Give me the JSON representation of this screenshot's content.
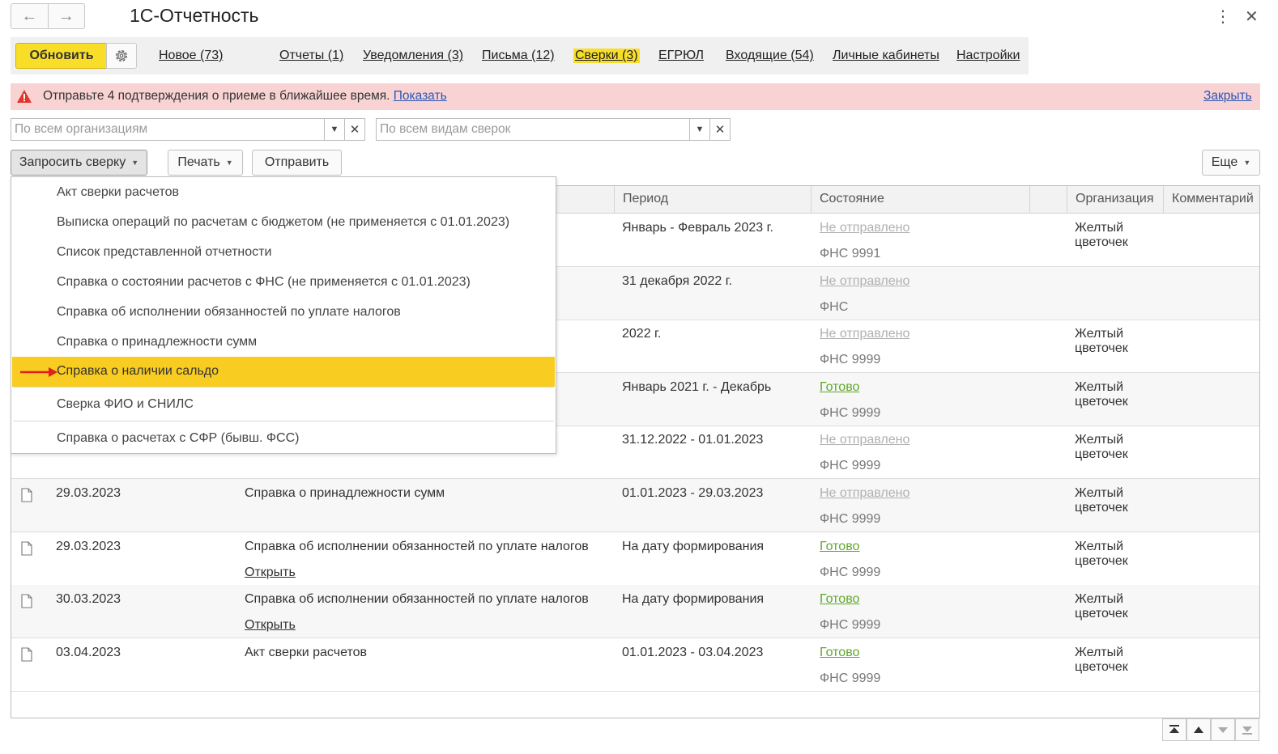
{
  "window": {
    "title": "1С-Отчетность",
    "back_icon": "arrow-left-icon",
    "forward_icon": "arrow-right-icon"
  },
  "toolbar": {
    "refresh_label": "Обновить",
    "tabs": [
      {
        "label": "Новое (73)",
        "active": false
      },
      {
        "label": "Отчеты (1)",
        "active": false
      },
      {
        "label": "Уведомления (3)",
        "active": false
      },
      {
        "label": "Письма (12)",
        "active": false
      },
      {
        "label": "Сверки (3)",
        "active": true
      },
      {
        "label": "ЕГРЮЛ",
        "active": false
      },
      {
        "label": "Входящие (54)",
        "active": false
      },
      {
        "label": "Личные кабинеты",
        "active": false
      },
      {
        "label": "Настройки",
        "active": false
      }
    ]
  },
  "alert": {
    "text": "Отправьте 4 подтверждения о приеме в ближайшее время.",
    "show_link": "Показать",
    "close_link": "Закрыть"
  },
  "filters": {
    "organizations": "По всем организациям",
    "reconciliation_types": "По всем видам сверок"
  },
  "commands": {
    "request": "Запросить сверку",
    "print": "Печать",
    "send": "Отправить",
    "more": "Еще"
  },
  "table": {
    "columns": [
      "Период",
      "Состояние",
      "Организация",
      "Комментарий"
    ],
    "rows": [
      {
        "date": "",
        "name": "",
        "open": "",
        "period": "Январь - Февраль 2023 г.",
        "status": "Не отправлено",
        "status_ok": false,
        "org": "ФНС 9991",
        "company": "Желтый цветочек"
      },
      {
        "date": "",
        "name": "",
        "open": "",
        "period": "31 декабря 2022 г.",
        "status": "Не отправлено",
        "status_ok": false,
        "org": "ФНС",
        "company": ""
      },
      {
        "date": "",
        "name": "",
        "open": "",
        "period": "2022 г.",
        "status": "Не отправлено",
        "status_ok": false,
        "org": "ФНС 9999",
        "company": "Желтый цветочек"
      },
      {
        "date": "",
        "name": "",
        "open": "",
        "period": "Январь 2021 г. - Декабрь",
        "status": "Готово",
        "status_ok": true,
        "org": "ФНС 9999",
        "company": "Желтый цветочек"
      },
      {
        "date": "",
        "name": "",
        "open": "",
        "period": "31.12.2022 - 01.01.2023",
        "status": "Не отправлено",
        "status_ok": false,
        "org": "ФНС 9999",
        "company": "Желтый цветочек"
      },
      {
        "date": "29.03.2023",
        "name": "Справка о принадлежности сумм",
        "open": "",
        "period": "01.01.2023 - 29.03.2023",
        "status": "Не отправлено",
        "status_ok": false,
        "org": "ФНС 9999",
        "company": "Желтый цветочек"
      },
      {
        "date": "29.03.2023",
        "name": "Справка об исполнении обязанностей по уплате налогов",
        "open": "Открыть",
        "period": "На дату формирования",
        "status": "Готово",
        "status_ok": true,
        "org": "ФНС 9999",
        "company": "Желтый цветочек"
      },
      {
        "date": "30.03.2023",
        "name": "Справка об исполнении обязанностей по уплате налогов",
        "open": "Открыть",
        "period": "На дату формирования",
        "status": "Готово",
        "status_ok": true,
        "org": "ФНС 9999",
        "company": "Желтый цветочек"
      },
      {
        "date": "03.04.2023",
        "name": "Акт сверки расчетов",
        "open": "",
        "period": "01.01.2023 - 03.04.2023",
        "status": "Готово",
        "status_ok": true,
        "org": "ФНС 9999",
        "company": "Желтый цветочек"
      }
    ]
  },
  "menu": {
    "items": [
      {
        "label": "Акт сверки расчетов",
        "highlighted": false
      },
      {
        "label": "Выписка операций по расчетам с бюджетом (не применяется с 01.01.2023)",
        "highlighted": false
      },
      {
        "label": "Список представленной отчетности",
        "highlighted": false
      },
      {
        "label": "Справка о состоянии расчетов с ФНС (не применяется с 01.01.2023)",
        "highlighted": false
      },
      {
        "label": "Справка об исполнении обязанностей по уплате налогов",
        "highlighted": false
      },
      {
        "label": "Справка о принадлежности сумм",
        "highlighted": false
      },
      {
        "label": "Справка о наличии сальдо",
        "highlighted": true
      },
      {
        "label": "Сверка ФИО и СНИЛС",
        "highlighted": false
      },
      {
        "label": "Справка о расчетах с СФР (бывш. ФСС)",
        "highlighted": false
      }
    ]
  },
  "colors": {
    "accent_yellow": "#f8de29",
    "highlight": "#f8cc20",
    "alert_bg": "#f9d3d3",
    "link": "#2a56b8",
    "ok_green": "#5fa829",
    "arrow_red": "#e0201a"
  }
}
